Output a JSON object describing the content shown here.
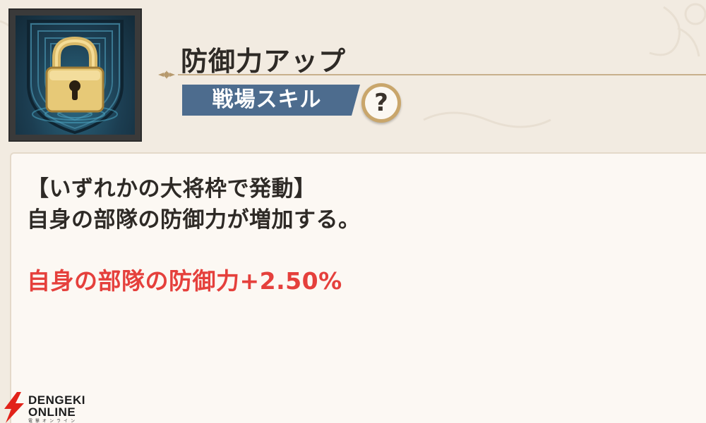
{
  "skill": {
    "name": "防御力アップ",
    "type_badge": "戦場スキル",
    "help_button_label": "?",
    "icon": "padlock-icon"
  },
  "description": {
    "condition": "【いずれかの大将枠で発動】",
    "summary": "自身の部隊の防御力が増加する。",
    "effect": "自身の部隊の防御力+2.50%"
  },
  "watermark": {
    "line1": "DENGEKI",
    "line2": "ONLINE",
    "sub": "電撃オンライン"
  },
  "colors": {
    "badge": "#4d6c8e",
    "effect_text": "#e5403c",
    "panel": "#fcf8f3",
    "background": "#f2ebe1"
  }
}
